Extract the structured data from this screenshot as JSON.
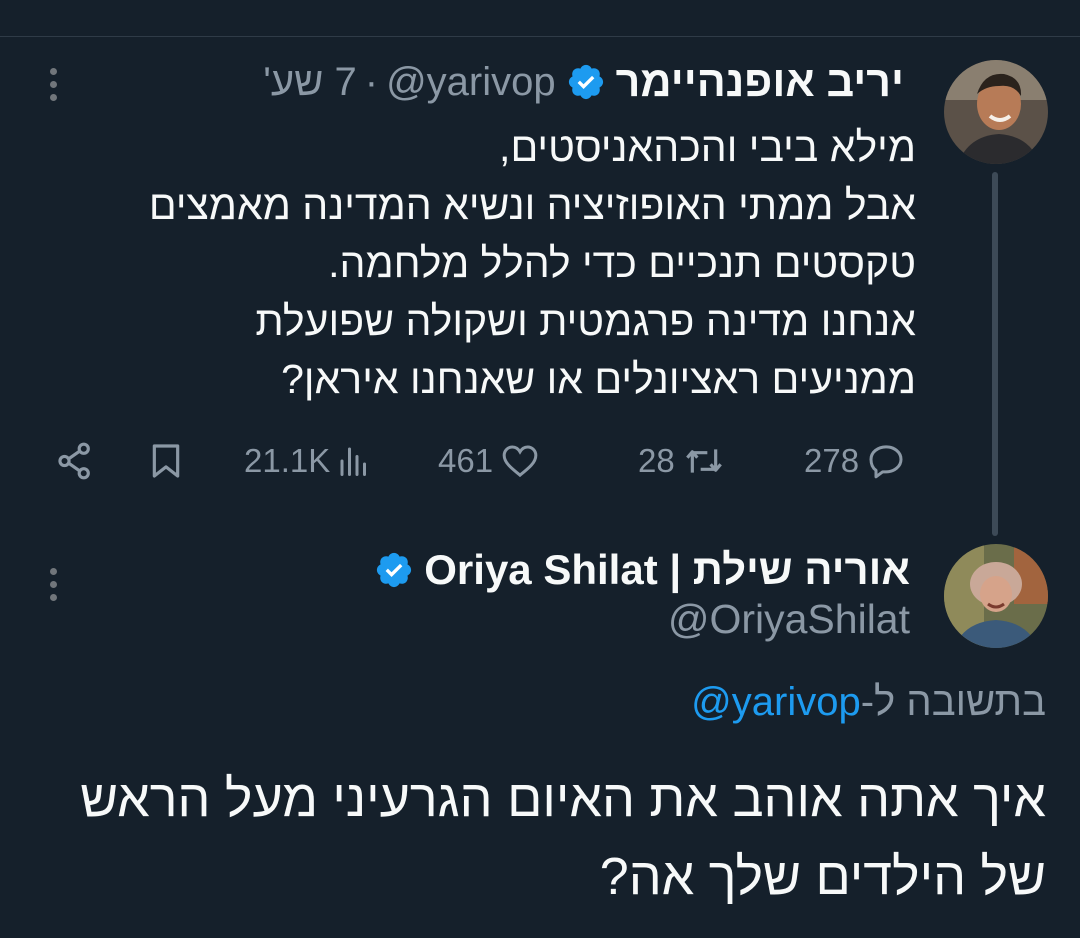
{
  "tweet1": {
    "author_name": "יריב אופנהיימר",
    "handle": "@yarivop",
    "separator": "·",
    "time": "7 שע'",
    "lines": [
      "מילא ביבי והכהאניסטים,",
      "אבל ממתי האופוזיציה ונשיא המדינה מאמצים",
      "טקסטים תנכיים כדי להלל מלחמה.",
      "אנחנו מדינה פרגמטית ושקולה שפועלת",
      "ממניעים ראציונלים או שאנחנו איראן?"
    ],
    "replies": "278",
    "retweets": "28",
    "likes": "461",
    "views": "21.1K"
  },
  "tweet2": {
    "author_name": "אוריה שילת | Oriya Shilat",
    "handle": "@OriyaShilat",
    "reply_prefix": "בתשובה ל-",
    "reply_mention": "@yarivop",
    "lines": [
      "איך אתה אוהב את האיום הגרעיני מעל הראש",
      "של הילדים שלך אה?"
    ]
  },
  "colors": {
    "background": "#15202b",
    "text": "#f7f9f9",
    "secondary": "#8b98a5",
    "accent": "#1d9bf0"
  },
  "icons": [
    "more-icon",
    "verified-badge-icon",
    "share-icon",
    "bookmark-icon",
    "views-icon",
    "like-icon",
    "retweet-icon",
    "reply-icon"
  ]
}
